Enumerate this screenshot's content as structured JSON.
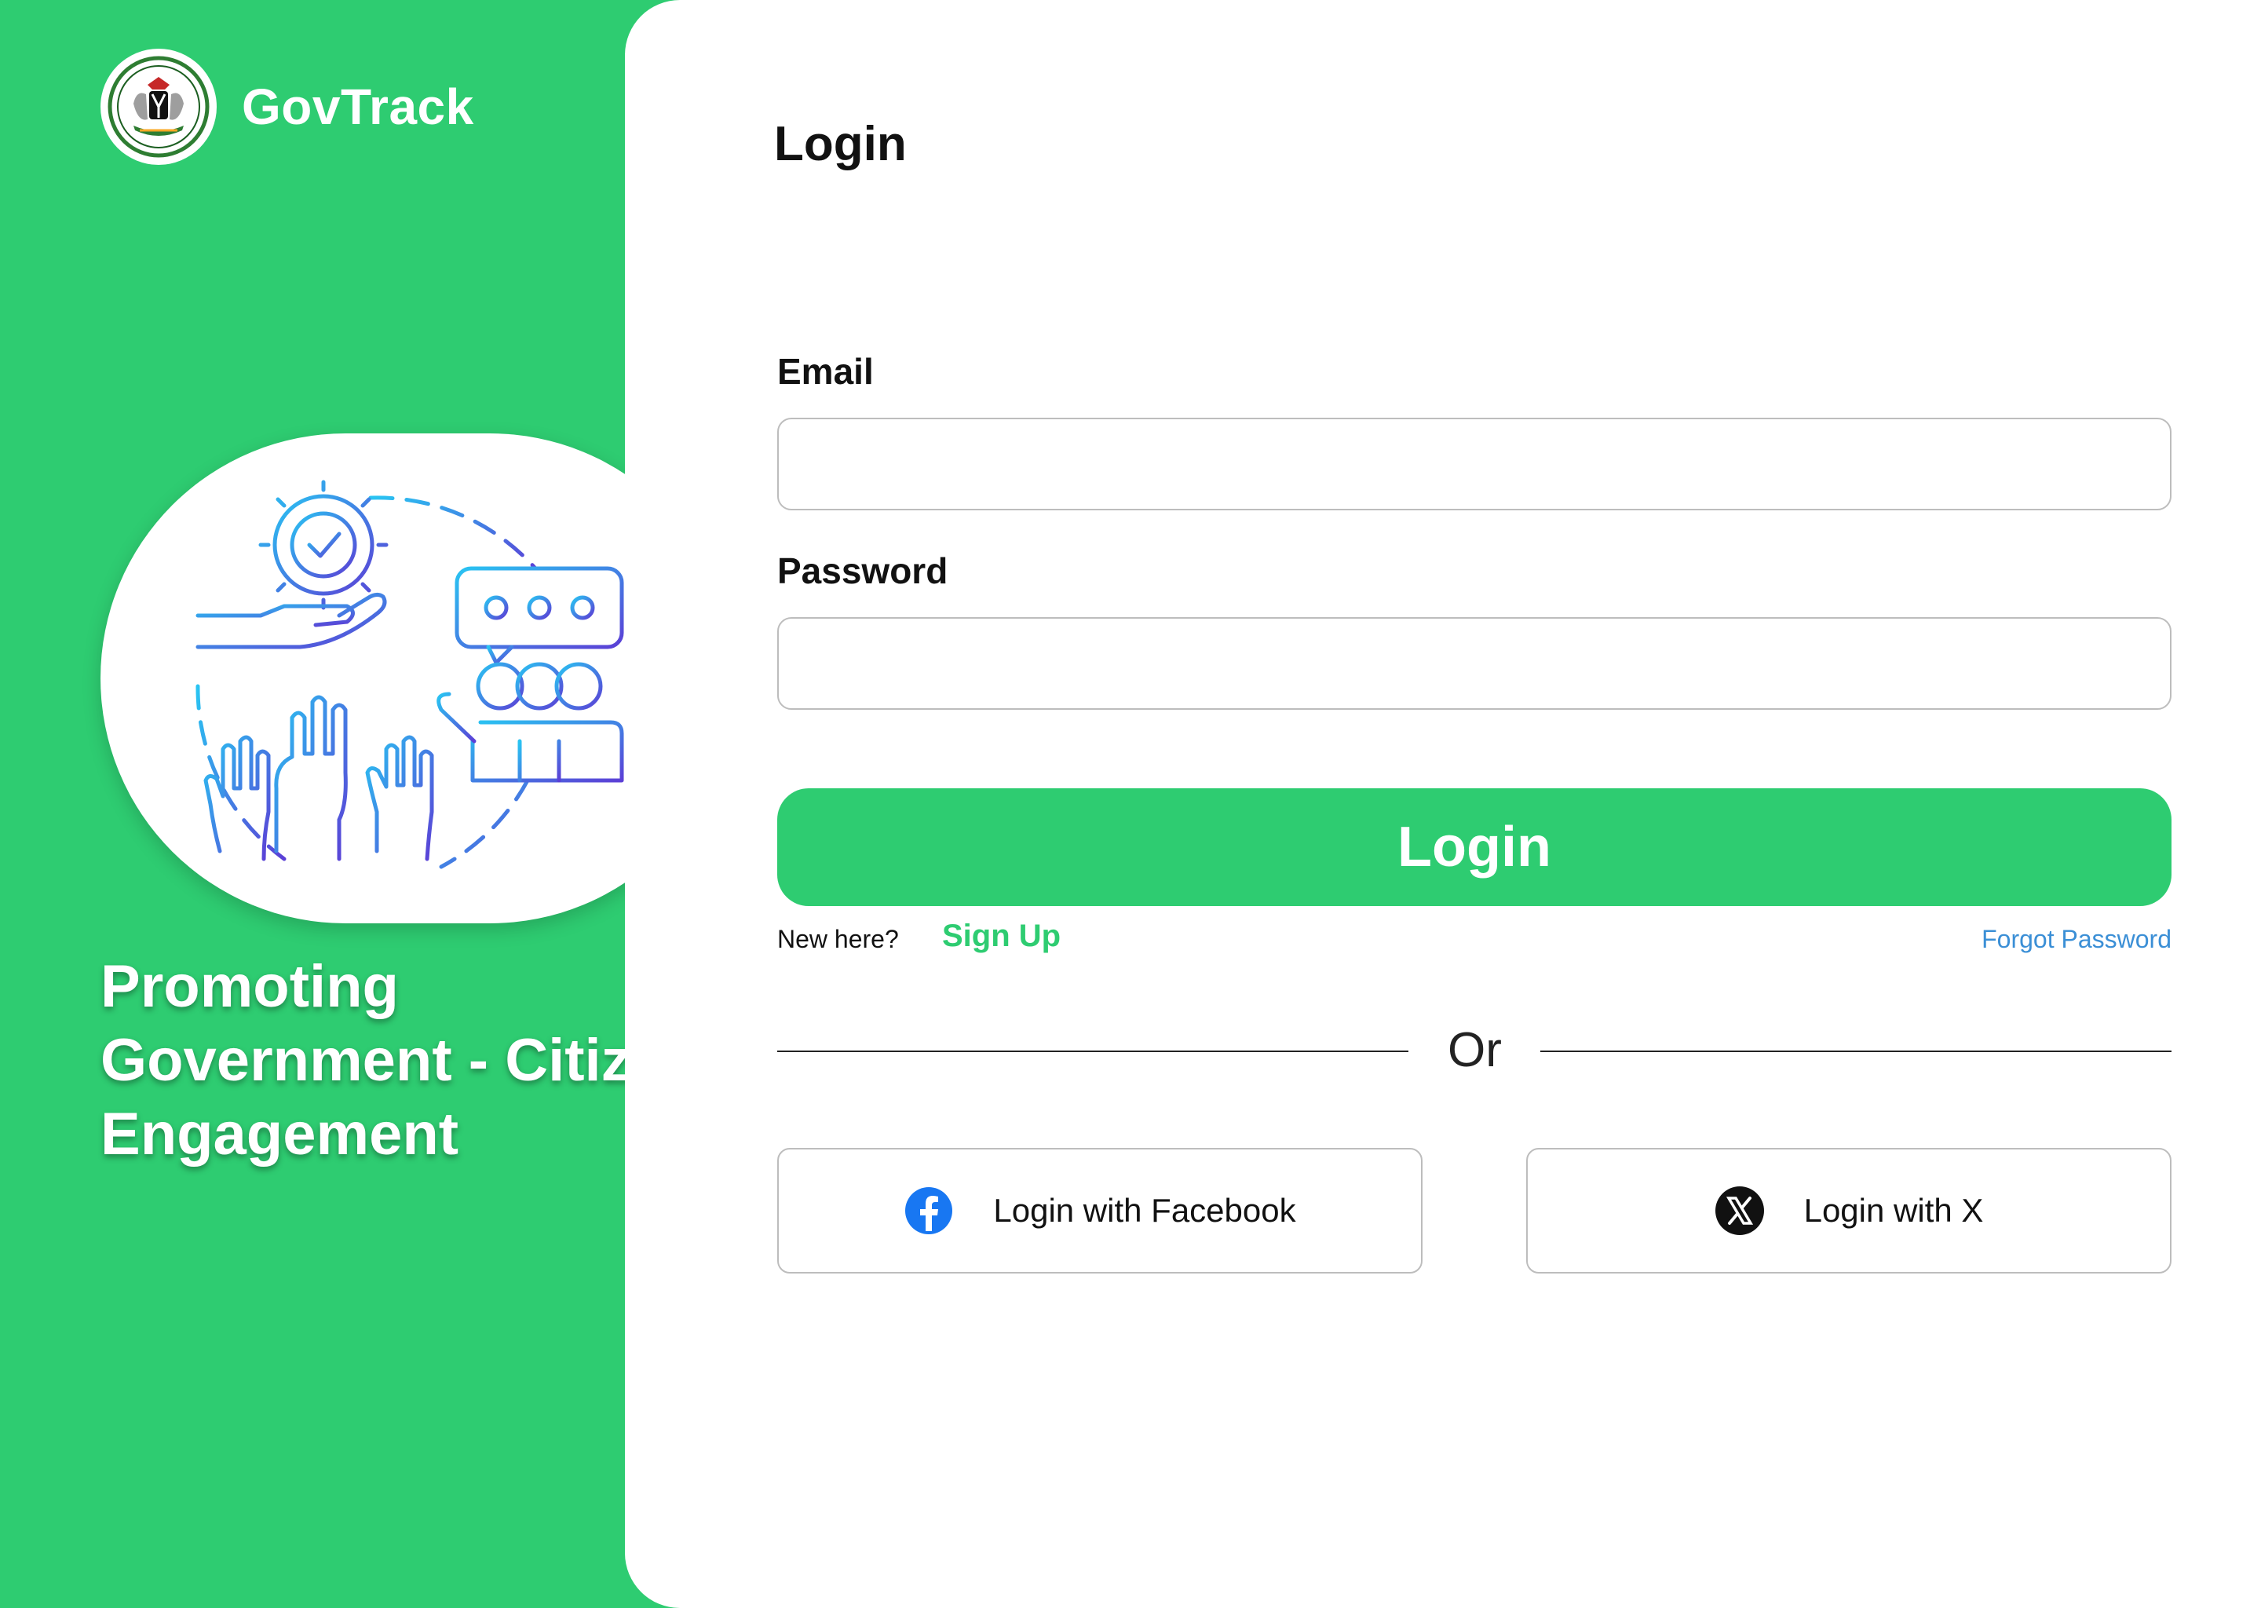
{
  "app": {
    "brand_name": "GovTrack",
    "tagline_lines": [
      "Promoting",
      "Government - Citizen",
      "Engagement"
    ]
  },
  "form": {
    "title": "Login",
    "email_label": "Email",
    "email_value": "",
    "password_label": "Password",
    "password_value": "",
    "login_button": "Login",
    "new_here_text": "New here?",
    "signup_link": "Sign Up",
    "forgot_link": "Forgot Password",
    "divider_text": "Or",
    "social": {
      "facebook_label": "Login with Facebook",
      "x_label": "Login with X"
    }
  },
  "colors": {
    "brand_green": "#2ecc71",
    "link_blue": "#3b8fd6",
    "facebook_blue": "#1877f2"
  },
  "icons": {
    "logo": "coat-of-arms-icon",
    "illustration": "government-citizen-engagement-illustration",
    "facebook": "facebook-icon",
    "x": "x-icon"
  }
}
